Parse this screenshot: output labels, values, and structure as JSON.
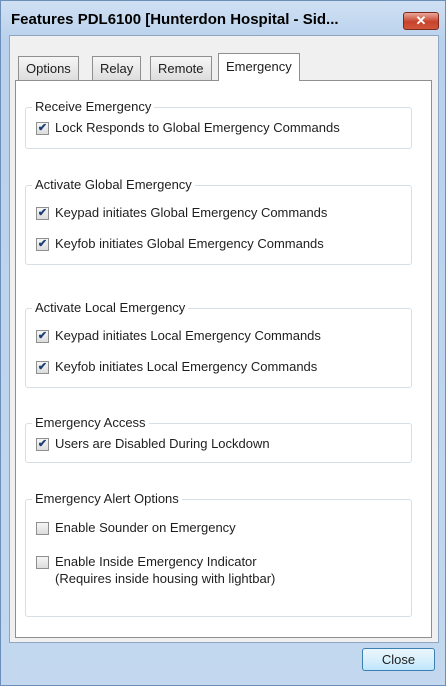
{
  "window": {
    "title": "Features PDL6100 [Hunterdon Hospital - Sid...",
    "close_glyph": "✕"
  },
  "tabs": [
    {
      "label": "Options",
      "active": false
    },
    {
      "label": "Relay",
      "active": false
    },
    {
      "label": "Remote",
      "active": false
    },
    {
      "label": "Emergency",
      "active": true
    }
  ],
  "groups": [
    {
      "label": "Receive Emergency",
      "items": [
        {
          "label": "Lock Responds to Global Emergency Commands",
          "checked": true
        }
      ]
    },
    {
      "label": "Activate Global Emergency",
      "items": [
        {
          "label": "Keypad initiates Global Emergency Commands",
          "checked": true
        },
        {
          "label": "Keyfob initiates Global Emergency Commands",
          "checked": true
        }
      ]
    },
    {
      "label": "Activate Local Emergency",
      "items": [
        {
          "label": "Keypad initiates Local Emergency Commands",
          "checked": true
        },
        {
          "label": "Keyfob initiates Local Emergency Commands",
          "checked": true
        }
      ]
    },
    {
      "label": "Emergency Access",
      "items": [
        {
          "label": "Users are Disabled During Lockdown",
          "checked": true
        }
      ]
    },
    {
      "label": "Emergency Alert Options",
      "items": [
        {
          "label": "Enable Sounder on Emergency",
          "checked": false
        },
        {
          "label": "Enable Inside Emergency Indicator",
          "sublabel": "(Requires inside housing with lightbar)",
          "checked": false
        }
      ]
    }
  ],
  "footer": {
    "close_label": "Close"
  },
  "check_glyph": "✔"
}
